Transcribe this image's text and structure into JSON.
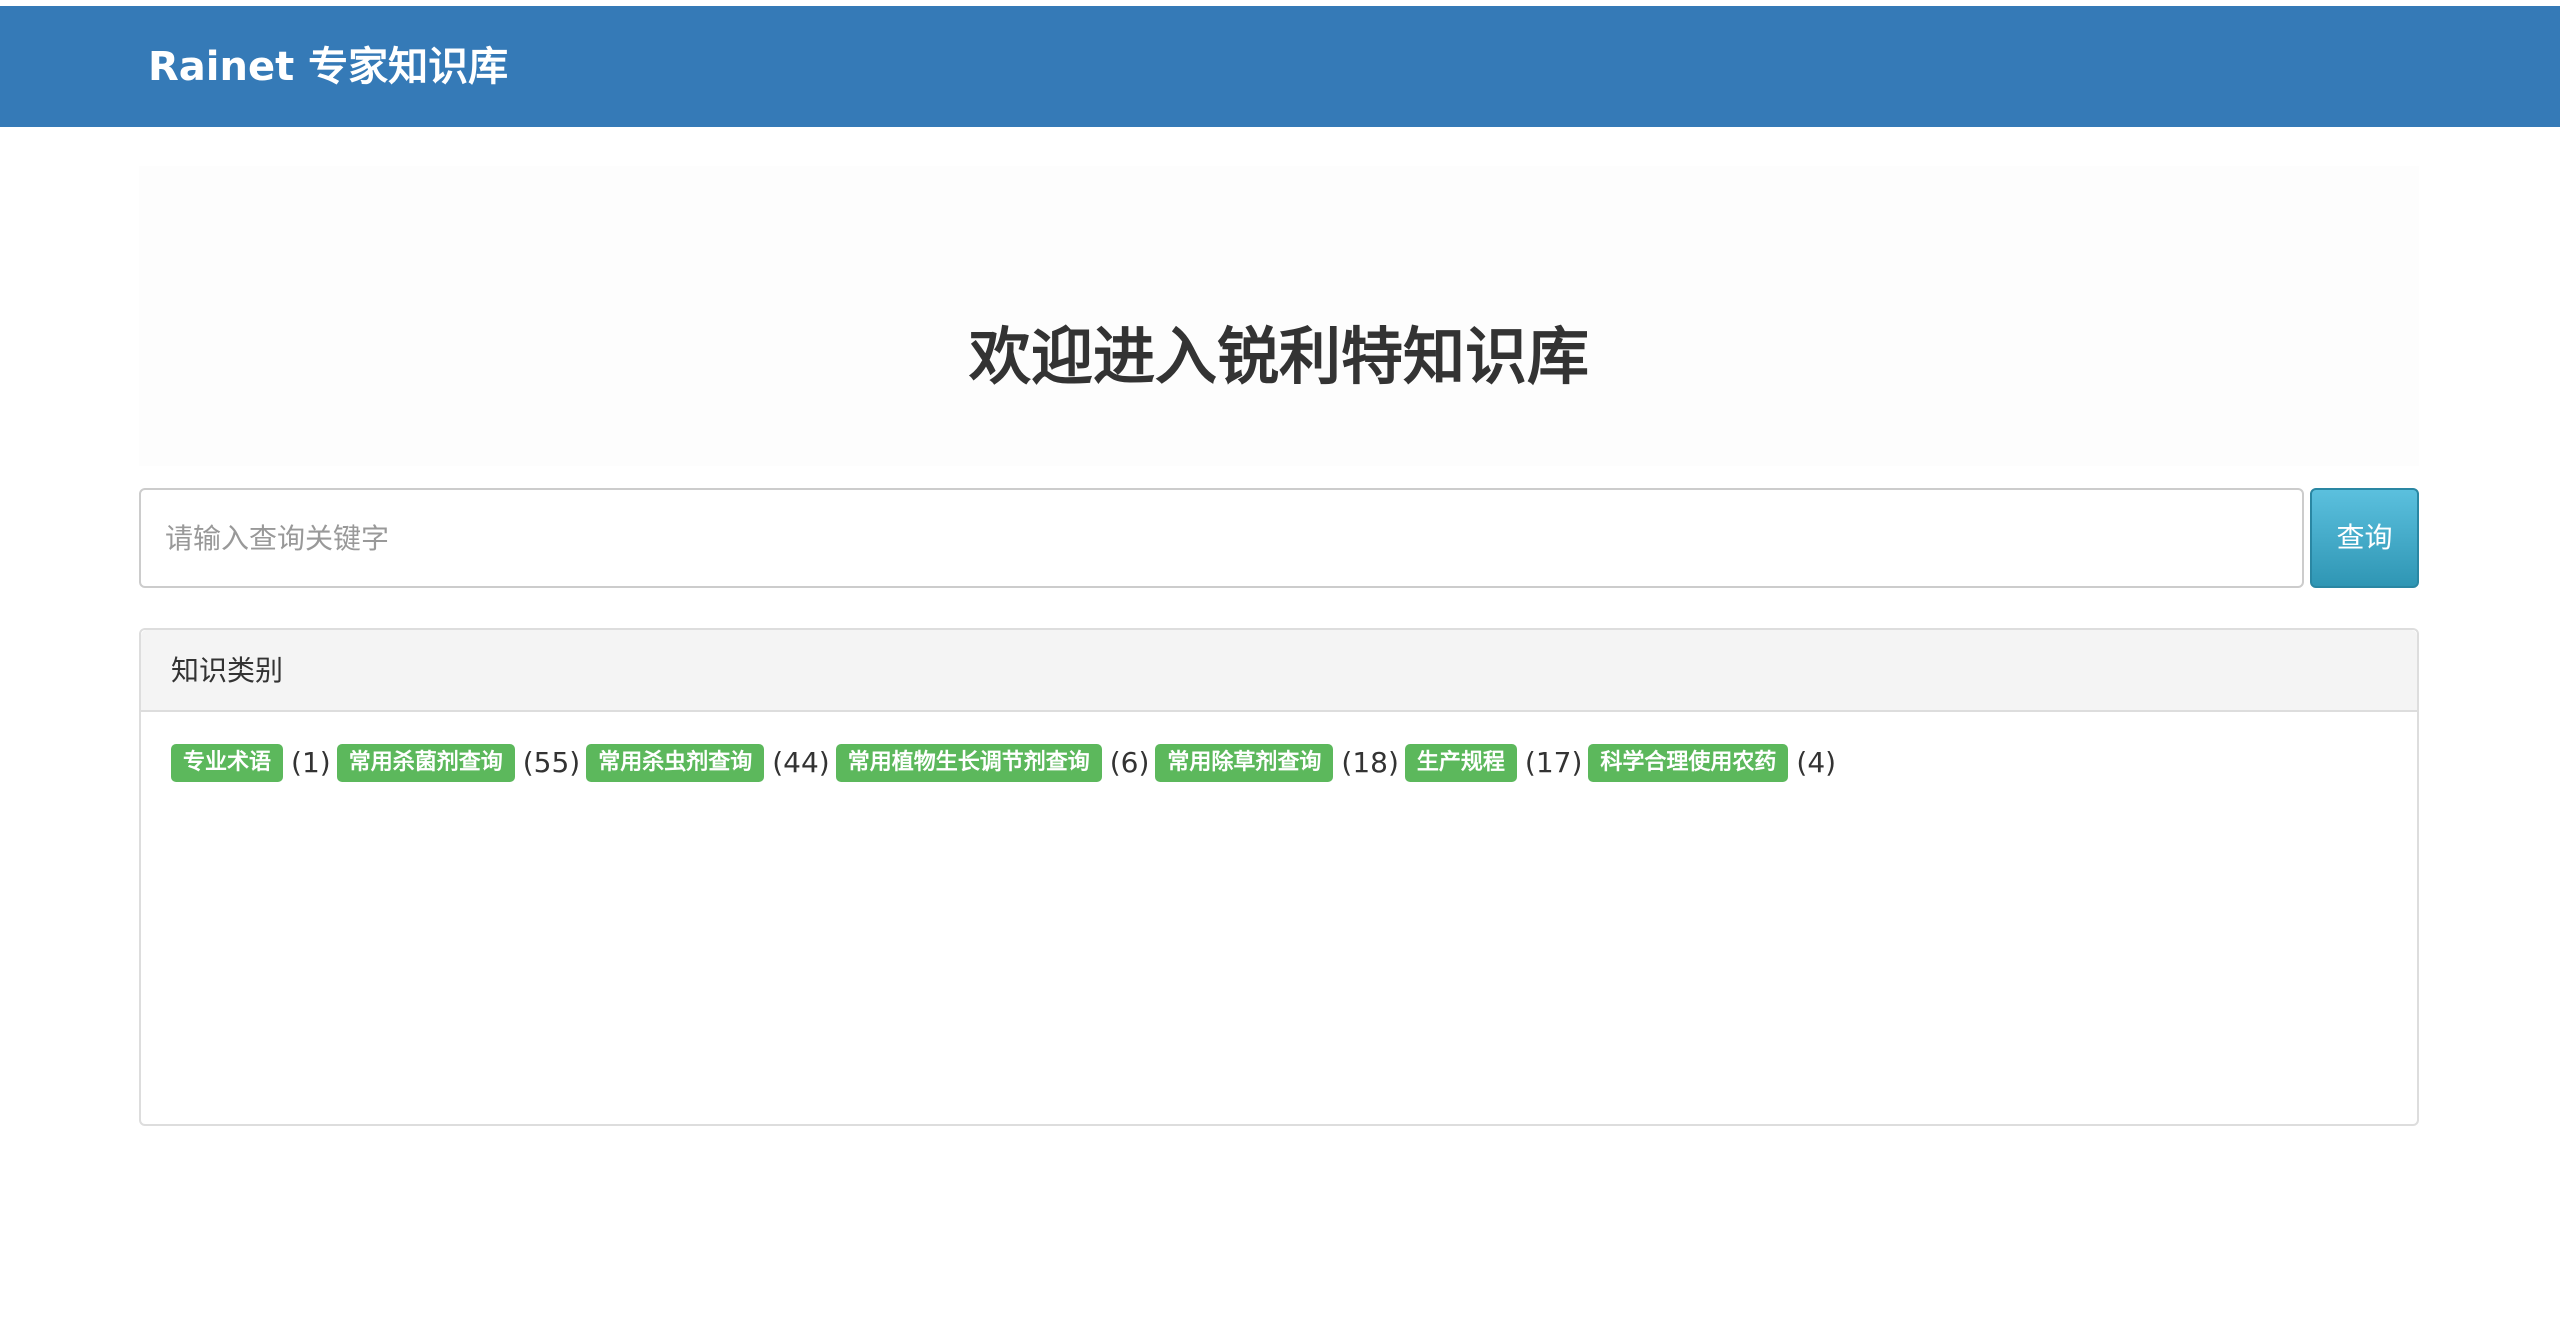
{
  "navbar": {
    "brand": "Rainet 专家知识库"
  },
  "jumbotron": {
    "title": "欢迎进入锐利特知识库"
  },
  "search": {
    "placeholder": "请输入查询关键字",
    "value": "",
    "button_label": "查询"
  },
  "colors": {
    "navbar": "#357ab7",
    "tag": "#5cb85c",
    "button": "#5bc0de"
  },
  "panel": {
    "title": "知识类别",
    "categories": [
      {
        "label": "专业术语",
        "count": "(1)"
      },
      {
        "label": "常用杀菌剂查询",
        "count": "(55)"
      },
      {
        "label": "常用杀虫剂查询",
        "count": "(44)"
      },
      {
        "label": "常用植物生长调节剂查询",
        "count": "(6)"
      },
      {
        "label": "常用除草剂查询",
        "count": "(18)"
      },
      {
        "label": "生产规程",
        "count": "(17)"
      },
      {
        "label": "科学合理使用农药",
        "count": "(4)"
      }
    ]
  }
}
